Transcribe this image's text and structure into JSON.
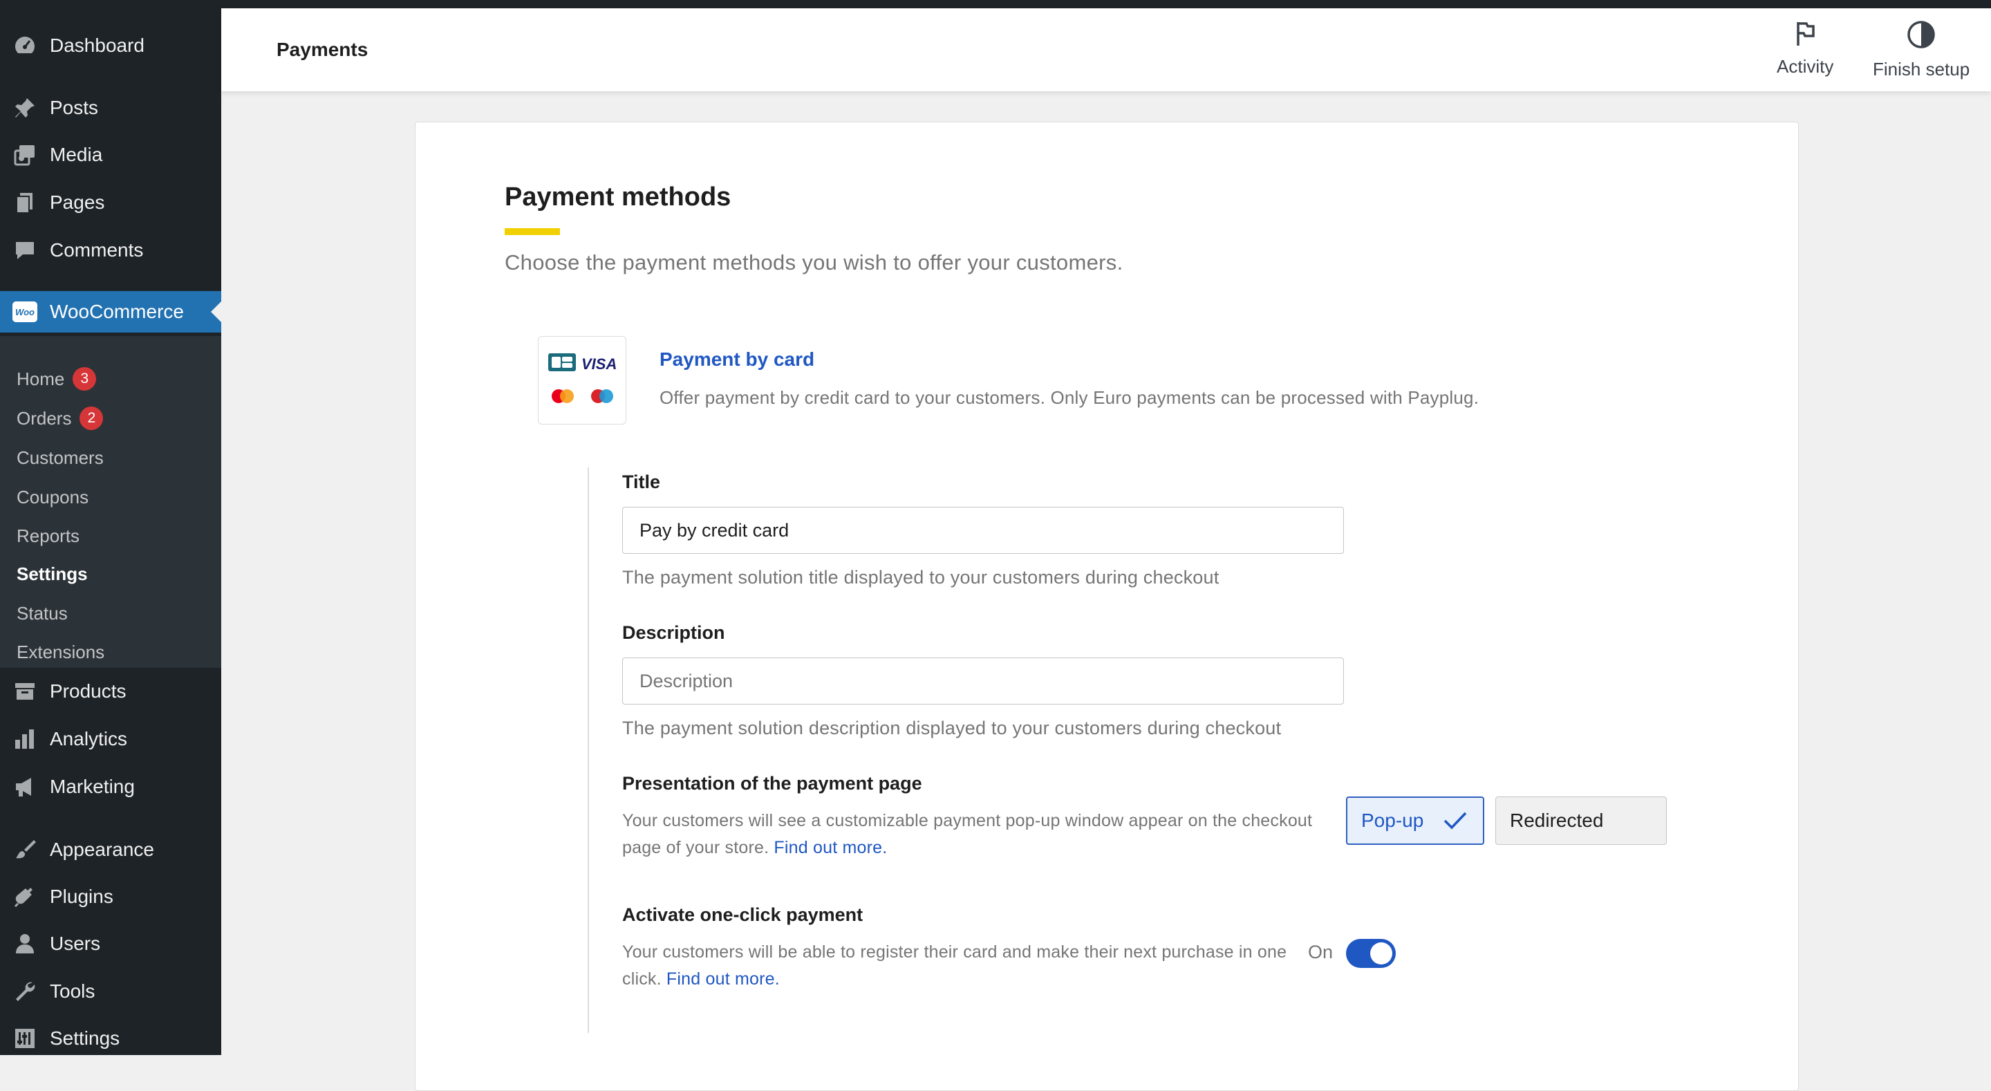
{
  "sidebar": {
    "top_items": [
      {
        "label": "Dashboard",
        "icon": "dashboard-icon"
      },
      {
        "label": "Posts",
        "icon": "pin-icon"
      },
      {
        "label": "Media",
        "icon": "media-icon"
      },
      {
        "label": "Pages",
        "icon": "pages-icon"
      },
      {
        "label": "Comments",
        "icon": "comment-icon"
      }
    ],
    "woocommerce": {
      "label": "WooCommerce",
      "logo_text": "Woo"
    },
    "submenu": [
      {
        "label": "Home",
        "badge": "3"
      },
      {
        "label": "Orders",
        "badge": "2"
      },
      {
        "label": "Customers"
      },
      {
        "label": "Coupons"
      },
      {
        "label": "Reports"
      },
      {
        "label": "Settings",
        "current": true
      },
      {
        "label": "Status"
      },
      {
        "label": "Extensions"
      }
    ],
    "bottom_items": [
      {
        "label": "Products",
        "icon": "archive-icon"
      },
      {
        "label": "Analytics",
        "icon": "bar-chart-icon"
      },
      {
        "label": "Marketing",
        "icon": "megaphone-icon"
      },
      {
        "label": "Appearance",
        "icon": "brush-icon"
      },
      {
        "label": "Plugins",
        "icon": "plug-icon"
      },
      {
        "label": "Users",
        "icon": "user-icon"
      },
      {
        "label": "Tools",
        "icon": "wrench-icon"
      },
      {
        "label": "Settings",
        "icon": "settings-icon"
      }
    ]
  },
  "header": {
    "title": "Payments",
    "activity_label": "Activity",
    "finish_setup_label": "Finish setup"
  },
  "section": {
    "title": "Payment methods",
    "subtitle": "Choose the payment methods you wish to offer your customers."
  },
  "payment_method": {
    "title": "Payment by card",
    "description": "Offer payment by credit card to your customers. Only Euro payments can be processed with Payplug.",
    "logo_visa_text": "VISA"
  },
  "form": {
    "title_label": "Title",
    "title_value": "Pay by credit card",
    "title_help": "The payment solution title displayed to your customers during checkout",
    "description_label": "Description",
    "description_placeholder": "Description",
    "description_help": "The payment solution description displayed to your customers during checkout",
    "presentation_label": "Presentation of the payment page",
    "presentation_text": "Your customers will see a customizable payment pop-up window appear on the checkout page of your store.",
    "presentation_link": "Find out more.",
    "option_popup": "Pop-up",
    "option_redirected": "Redirected",
    "oneclick_label": "Activate one-click payment",
    "oneclick_text": "Your customers will be able to register their card and make their next purchase in one click.",
    "oneclick_link": "Find out more.",
    "oneclick_state": "On"
  },
  "colors": {
    "sidebar_bg": "#1d2327",
    "submenu_bg": "#2c3338",
    "woo_active": "#2271b1",
    "accent_link": "#1f57c3",
    "underline_yellow": "#f0d000",
    "badge_red": "#d63638"
  }
}
